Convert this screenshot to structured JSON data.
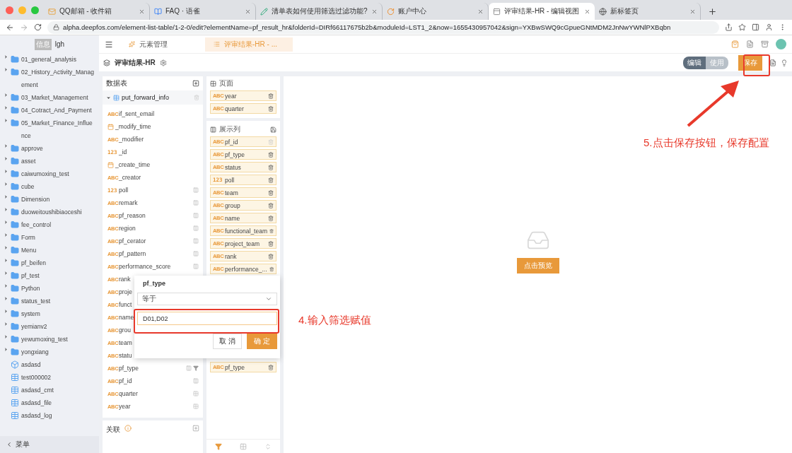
{
  "browser": {
    "tabs": [
      {
        "title": "QQ邮箱 - 收件箱",
        "kind": "mail",
        "selected": false
      },
      {
        "title": "FAQ · 语雀",
        "kind": "doc",
        "selected": false
      },
      {
        "title": "清单表如何使用筛选过滤功能?",
        "kind": "note",
        "selected": false
      },
      {
        "title": "账户中心",
        "kind": "account",
        "selected": false
      },
      {
        "title": "评审结果-HR - 编辑视图",
        "kind": "app",
        "selected": true
      },
      {
        "title": "新标签页",
        "kind": "globe",
        "selected": false
      }
    ],
    "url": "alpha.deepfos.com/element-list-table/1-2-0/edit?elementName=pf_result_hr&folderId=DIRf66117675b2b&moduleId=LST1_2&now=1655430957042&sign=YXBwSWQ9cGpueGNtMDM2JnNwYWNlPXBqbn"
  },
  "sidebar": {
    "user_badge": "信息",
    "user": "lgh",
    "items": [
      {
        "label": "01_general_analysis",
        "kind": "folder"
      },
      {
        "label": "02_History_Activity_Management",
        "kind": "folder"
      },
      {
        "label": "03_Market_Management",
        "kind": "folder"
      },
      {
        "label": "04_Cotract_And_Payment",
        "kind": "folder"
      },
      {
        "label": "05_Market_Finance_Influence",
        "kind": "folder"
      },
      {
        "label": "approve",
        "kind": "folder"
      },
      {
        "label": "asset",
        "kind": "folder"
      },
      {
        "label": "caiwumoxing_test",
        "kind": "folder"
      },
      {
        "label": "cube",
        "kind": "folder"
      },
      {
        "label": "Dimension",
        "kind": "folder"
      },
      {
        "label": "duoweitoushibiaoceshi",
        "kind": "folder"
      },
      {
        "label": "fee_control",
        "kind": "folder"
      },
      {
        "label": "Form",
        "kind": "folder"
      },
      {
        "label": "Menu",
        "kind": "folder"
      },
      {
        "label": "pf_beifen",
        "kind": "folder"
      },
      {
        "label": "pf_test",
        "kind": "folder"
      },
      {
        "label": "Python",
        "kind": "folder"
      },
      {
        "label": "status_test",
        "kind": "folder"
      },
      {
        "label": "system",
        "kind": "folder"
      },
      {
        "label": "yemianv2",
        "kind": "folder"
      },
      {
        "label": "yewumoxing_test",
        "kind": "folder"
      },
      {
        "label": "yongxiang",
        "kind": "folder"
      },
      {
        "label": "asdasd",
        "kind": "cube"
      },
      {
        "label": "test000002",
        "kind": "table"
      },
      {
        "label": "asdasd_cmt",
        "kind": "table"
      },
      {
        "label": "asdasd_file",
        "kind": "table"
      },
      {
        "label": "asdasd_log",
        "kind": "table"
      }
    ],
    "footer": "菜单"
  },
  "app_tabs": [
    {
      "label": "元素管理",
      "selected": false
    },
    {
      "label": "评审结果-HR - ...",
      "selected": true
    }
  ],
  "header": {
    "title": "评审结果-HR",
    "modes": [
      {
        "label": "编辑",
        "selected": true
      },
      {
        "label": "使用",
        "selected": false
      }
    ],
    "save": "保存"
  },
  "data_panel": {
    "title": "数据表",
    "table": "put_forward_info",
    "fields": [
      {
        "kind": "text",
        "badge": "ABC",
        "name": "if_sent_email"
      },
      {
        "kind": "date",
        "name": "_modify_time"
      },
      {
        "kind": "text",
        "badge": "ABC",
        "name": "_modifier"
      },
      {
        "kind": "number",
        "badge": "123",
        "name": "_id"
      },
      {
        "kind": "date",
        "name": "_create_time"
      },
      {
        "kind": "text",
        "badge": "ABC",
        "name": "_creator"
      },
      {
        "kind": "number",
        "badge": "123",
        "name": "poll",
        "in_columns": true
      },
      {
        "kind": "text",
        "badge": "ABC",
        "name": "remark",
        "in_columns": true
      },
      {
        "kind": "text",
        "badge": "ABC",
        "name": "pf_reason",
        "in_columns": true
      },
      {
        "kind": "text",
        "badge": "ABC",
        "name": "region",
        "in_columns": true
      },
      {
        "kind": "text",
        "badge": "ABC",
        "name": "pf_cerator",
        "in_columns": true
      },
      {
        "kind": "text",
        "badge": "ABC",
        "name": "pf_pattern",
        "in_columns": true
      },
      {
        "kind": "text",
        "badge": "ABC",
        "name": "performance_score",
        "in_columns": true
      },
      {
        "kind": "text",
        "badge": "ABC",
        "name": "rank"
      },
      {
        "kind": "text",
        "badge": "ABC",
        "name": "proje"
      },
      {
        "kind": "text",
        "badge": "ABC",
        "name": "funct"
      },
      {
        "kind": "text",
        "badge": "ABC",
        "name": "name"
      },
      {
        "kind": "text",
        "badge": "ABC",
        "name": "grou"
      },
      {
        "kind": "text",
        "badge": "ABC",
        "name": "team"
      },
      {
        "kind": "text",
        "badge": "ABC",
        "name": "statu"
      },
      {
        "kind": "text",
        "badge": "ABC",
        "name": "pf_type",
        "in_columns": true,
        "filtered": true
      },
      {
        "kind": "text",
        "badge": "ABC",
        "name": "pf_id",
        "in_columns": true
      },
      {
        "kind": "text",
        "badge": "ABC",
        "name": "quarter",
        "in_page": true
      },
      {
        "kind": "text",
        "badge": "ABC",
        "name": "year",
        "in_page": true
      }
    ],
    "relations": "关联"
  },
  "config_panel": {
    "page_title": "页面",
    "page_items": [
      {
        "kind": "text",
        "badge": "ABC",
        "name": "year",
        "removable": true
      },
      {
        "kind": "text",
        "badge": "ABC",
        "name": "quarter",
        "removable": true
      }
    ],
    "columns_title": "展示列",
    "column_items": [
      {
        "kind": "text",
        "badge": "ABC",
        "name": "pf_id",
        "removable": false
      },
      {
        "kind": "text",
        "badge": "ABC",
        "name": "pf_type",
        "removable": true
      },
      {
        "kind": "text",
        "badge": "ABC",
        "name": "status",
        "removable": true
      },
      {
        "kind": "number",
        "badge": "123",
        "name": "poll",
        "removable": true
      },
      {
        "kind": "text",
        "badge": "ABC",
        "name": "team",
        "removable": true
      },
      {
        "kind": "text",
        "badge": "ABC",
        "name": "group",
        "removable": true
      },
      {
        "kind": "text",
        "badge": "ABC",
        "name": "name",
        "removable": true
      },
      {
        "kind": "text",
        "badge": "ABC",
        "name": "functional_team",
        "removable": true
      },
      {
        "kind": "text",
        "badge": "ABC",
        "name": "project_team",
        "removable": true
      },
      {
        "kind": "text",
        "badge": "ABC",
        "name": "rank",
        "removable": true
      },
      {
        "kind": "text",
        "badge": "ABC",
        "name": "performance_...",
        "removable": true
      }
    ],
    "filter_items": [
      {
        "kind": "text",
        "badge": "ABC",
        "name": "pf_type",
        "removable": true
      }
    ],
    "tools": [
      {
        "kind": "filter",
        "selected": true
      },
      {
        "kind": "layout",
        "selected": false
      },
      {
        "kind": "sort",
        "selected": false
      }
    ]
  },
  "canvas": {
    "preview": "点击预览"
  },
  "filter_popup": {
    "field": "pf_type",
    "operator": "等于",
    "value": "D01,D02",
    "cancel": "取 消",
    "confirm": "确 定"
  },
  "notes": {
    "input_note": "4.输入筛选赋值",
    "save_note": "5.点击保存按钮，保存配置"
  }
}
